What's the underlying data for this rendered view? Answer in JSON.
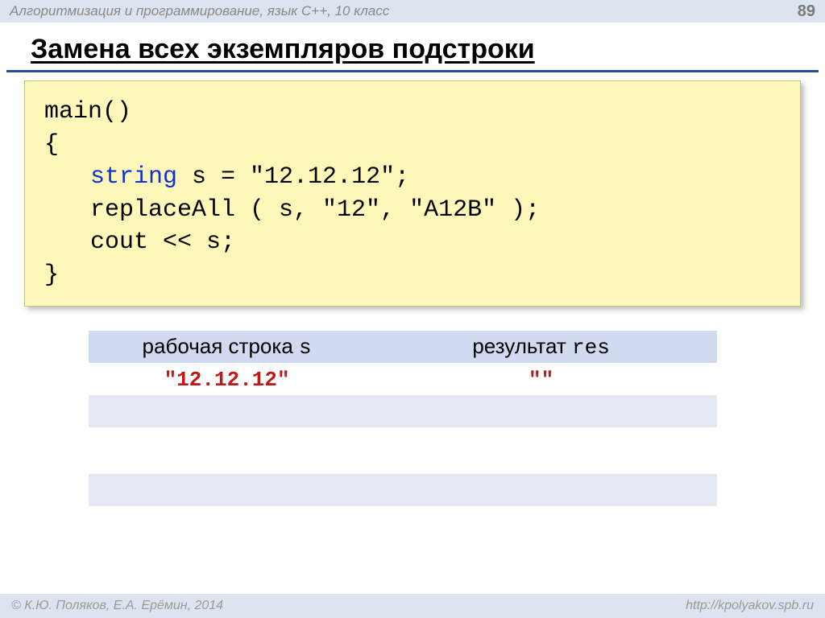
{
  "header": {
    "subject": "Алгоритмизация и программирование, язык С++, 10 класс",
    "page_number": "89"
  },
  "title": "Замена всех экземпляров подстроки",
  "code": {
    "line1": "main()",
    "line2": "{",
    "kw_string": "string",
    "line3_rest": " s = \"12.12.12\";",
    "line4": "replaceAll ( s, \"12\", \"A12B\" );",
    "line5": "cout << s;",
    "line6": "}"
  },
  "table": {
    "header_left_text": "рабочая строка ",
    "header_left_mono": "s",
    "header_right_text": "результат ",
    "header_right_mono": "res",
    "row1_left": "\"12.12.12\"",
    "row1_right": "\"\""
  },
  "footer": {
    "left": "© К.Ю. Поляков, Е.А. Ерёмин, 2014",
    "right": "http://kpolyakov.spb.ru"
  }
}
